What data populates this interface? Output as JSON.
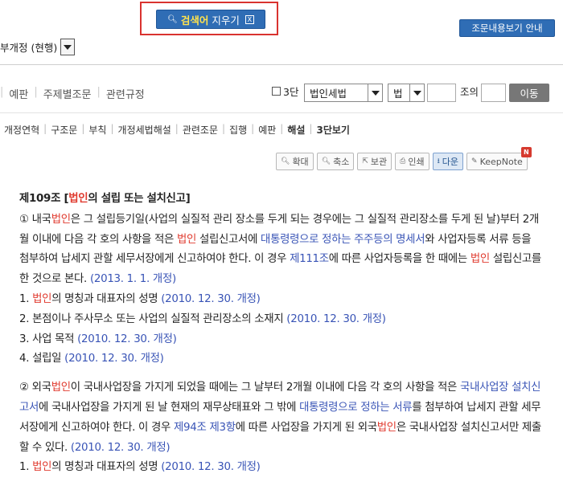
{
  "header": {
    "search_clear": {
      "highlight": "검색어",
      "rest": " 지우기",
      "close": "X"
    },
    "view_article_label": "조문내용보기 안내",
    "revision_select_value": "부개정 (현행)"
  },
  "nav_tabs": [
    "예판",
    "주제별조문",
    "관련규정"
  ],
  "controls": {
    "three_col_label": "3단",
    "law_select_value": "법인세법",
    "type_select_value": "법",
    "article_suffix": "조의",
    "go_label": "이동"
  },
  "sub_tabs": [
    {
      "label": "개정연혁",
      "bold": false
    },
    {
      "label": "구조문",
      "bold": false
    },
    {
      "label": "부칙",
      "bold": false
    },
    {
      "label": "개정세법해설",
      "bold": false
    },
    {
      "label": "관련조문",
      "bold": false
    },
    {
      "label": "집행",
      "bold": false
    },
    {
      "label": "예판",
      "bold": false
    },
    {
      "label": "해설",
      "bold": true
    },
    {
      "label": "3단보기",
      "bold": true
    }
  ],
  "toolbar": {
    "zoom_in": "확대",
    "zoom_out": "축소",
    "save": "보관",
    "print": "인쇄",
    "download": "다운",
    "keepnote": "KeepNote",
    "badge": "N"
  },
  "article": {
    "title_prefix": "제109조 [",
    "title_red": "법인",
    "title_suffix": "의 설립 또는 설치신고]",
    "p1": {
      "t1": "① 내국",
      "r1": "법인",
      "t2": "은 그 설립등기일(사업의 실질적 관리 장소를 두게 되는 경우에는 그 실질적 관리장소를 두게 된 날)부터 2개월 이내에 다음 각 호의 사항을 적은 ",
      "r2": "법인",
      "t3": " 설립신고서에 ",
      "b1": "대통령령으로 정하는 주주등의 명세서",
      "t4": "와 사업자등록 서류 등을 첨부하여 납세지 관할 세무서장에게 신고하여야 한다. 이 경우 ",
      "b2": "제111조",
      "t5": "에 따른 사업자등록을 한 때에는 ",
      "r3": "법인",
      "t6": " 설립신고를 한 것으로 본다. ",
      "b3": "(2013. 1. 1. 개정)"
    },
    "items1": [
      {
        "t1": "1. ",
        "r": "법인",
        "t2": "의 명칭과 대표자의 성명 ",
        "b": "(2010. 12. 30. 개정)"
      },
      {
        "t1": "2. 본점이나 주사무소 또는 사업의 실질적 관리장소의 소재지 ",
        "r": "",
        "t2": "",
        "b": "(2010. 12. 30. 개정)"
      },
      {
        "t1": "3. 사업 목적 ",
        "r": "",
        "t2": "",
        "b": "(2010. 12. 30. 개정)"
      },
      {
        "t1": "4. 설립일 ",
        "r": "",
        "t2": "",
        "b": "(2010. 12. 30. 개정)"
      }
    ],
    "p2": {
      "t1": "② 외국",
      "r1": "법인",
      "t2": "이 국내사업장을 가지게 되었을 때에는 그 날부터 2개월 이내에 다음 각 호의 사항을 적은 ",
      "b1": "국내사업장 설치신고서",
      "t3": "에 국내사업장을 가지게 된 날 현재의 재무상태표와 그 밖에 ",
      "b2": "대통령령으로 정하는 서류",
      "t4": "를 첨부하여 납세지 관할 세무서장에게 신고하여야 한다. 이 경우 ",
      "b3": "제94조 제3항",
      "t5": "에 따른 사업장을 가지게 된 외국",
      "r2": "법인",
      "t6": "은 국내사업장 설치신고서만 제출할 수 있다. ",
      "b4": "(2010. 12. 30. 개정)"
    },
    "items2": [
      {
        "t1": "1. ",
        "r": "법인",
        "t2": "의 명칭과 대표자의 성명 ",
        "b": "(2010. 12. 30. 개정)"
      }
    ]
  }
}
